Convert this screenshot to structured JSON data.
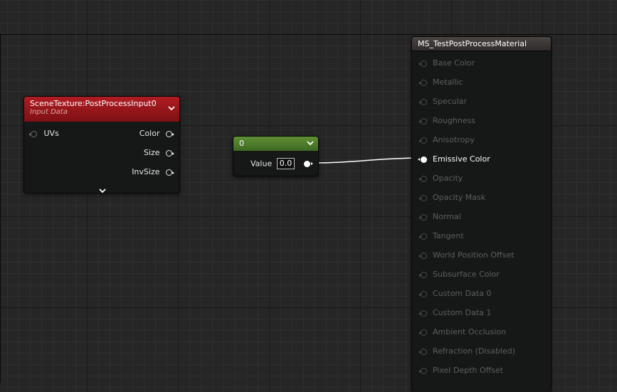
{
  "scene_texture_node": {
    "title": "SceneTexture:PostProcessInput0",
    "subtitle": "Input Data",
    "inputs": [
      {
        "label": "UVs"
      }
    ],
    "outputs": [
      {
        "label": "Color"
      },
      {
        "label": "Size"
      },
      {
        "label": "InvSize"
      }
    ],
    "header_color": "#a0151a"
  },
  "constant_node": {
    "title": "0",
    "value_label": "Value",
    "value": "0.0",
    "header_color": "#4d7a2a"
  },
  "material_node": {
    "title": "MS_TestPostProcessMaterial",
    "pins": [
      {
        "label": "Base Color",
        "active": false
      },
      {
        "label": "Metallic",
        "active": false
      },
      {
        "label": "Specular",
        "active": false
      },
      {
        "label": "Roughness",
        "active": false
      },
      {
        "label": "Anisotropy",
        "active": false
      },
      {
        "label": "Emissive Color",
        "active": true
      },
      {
        "label": "Opacity",
        "active": false
      },
      {
        "label": "Opacity Mask",
        "active": false
      },
      {
        "label": "Normal",
        "active": false
      },
      {
        "label": "Tangent",
        "active": false
      },
      {
        "label": "World Position Offset",
        "active": false
      },
      {
        "label": "Subsurface Color",
        "active": false
      },
      {
        "label": "Custom Data 0",
        "active": false
      },
      {
        "label": "Custom Data 1",
        "active": false
      },
      {
        "label": "Ambient Occlusion",
        "active": false
      },
      {
        "label": "Refraction (Disabled)",
        "active": false
      },
      {
        "label": "Pixel Depth Offset",
        "active": false
      }
    ]
  },
  "colors": {
    "grid_background": "#262626",
    "node_body": "#151816",
    "wire": "#ffffff"
  }
}
